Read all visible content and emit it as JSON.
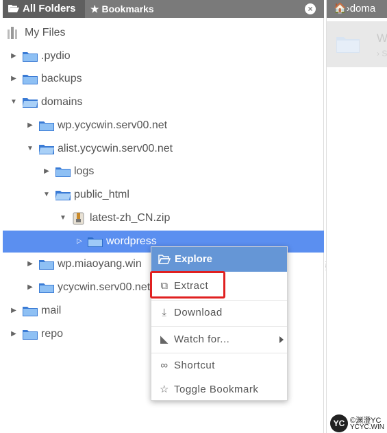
{
  "tabs": {
    "all_folders": "All Folders",
    "bookmarks": "Bookmarks",
    "close_symbol": "×"
  },
  "right": {
    "breadcrumb": "doma",
    "header_title": "W",
    "header_sub": "› S"
  },
  "tree": {
    "root": "My Files",
    "pydio": ".pydio",
    "backups": "backups",
    "domains": "domains",
    "wp_ycycwin": "wp.ycycwin.serv00.net",
    "alist": "alist.ycycwin.serv00.net",
    "logs": "logs",
    "public_html": "public_html",
    "zip": "latest-zh_CN.zip",
    "wordpress": "wordpress",
    "wp_miaoyang": "wp.miaoyang.win",
    "ycycwin": "ycycwin.serv00.net",
    "mail": "mail",
    "repo": "repo"
  },
  "context_menu": {
    "header": "Explore",
    "items": [
      "Extract",
      "Download",
      "Watch for...",
      "Shortcut",
      "Toggle Bookmark"
    ]
  },
  "watermark": {
    "logo": "YC",
    "line1": "©渊澄YC",
    "line2": "YCYC.WIN"
  },
  "colors": {
    "tabbar": "#7a7a7a",
    "selection": "#5b8ff0",
    "menu_header": "#6596d6",
    "highlight": "#e02020",
    "folder": "#4a90e2"
  }
}
